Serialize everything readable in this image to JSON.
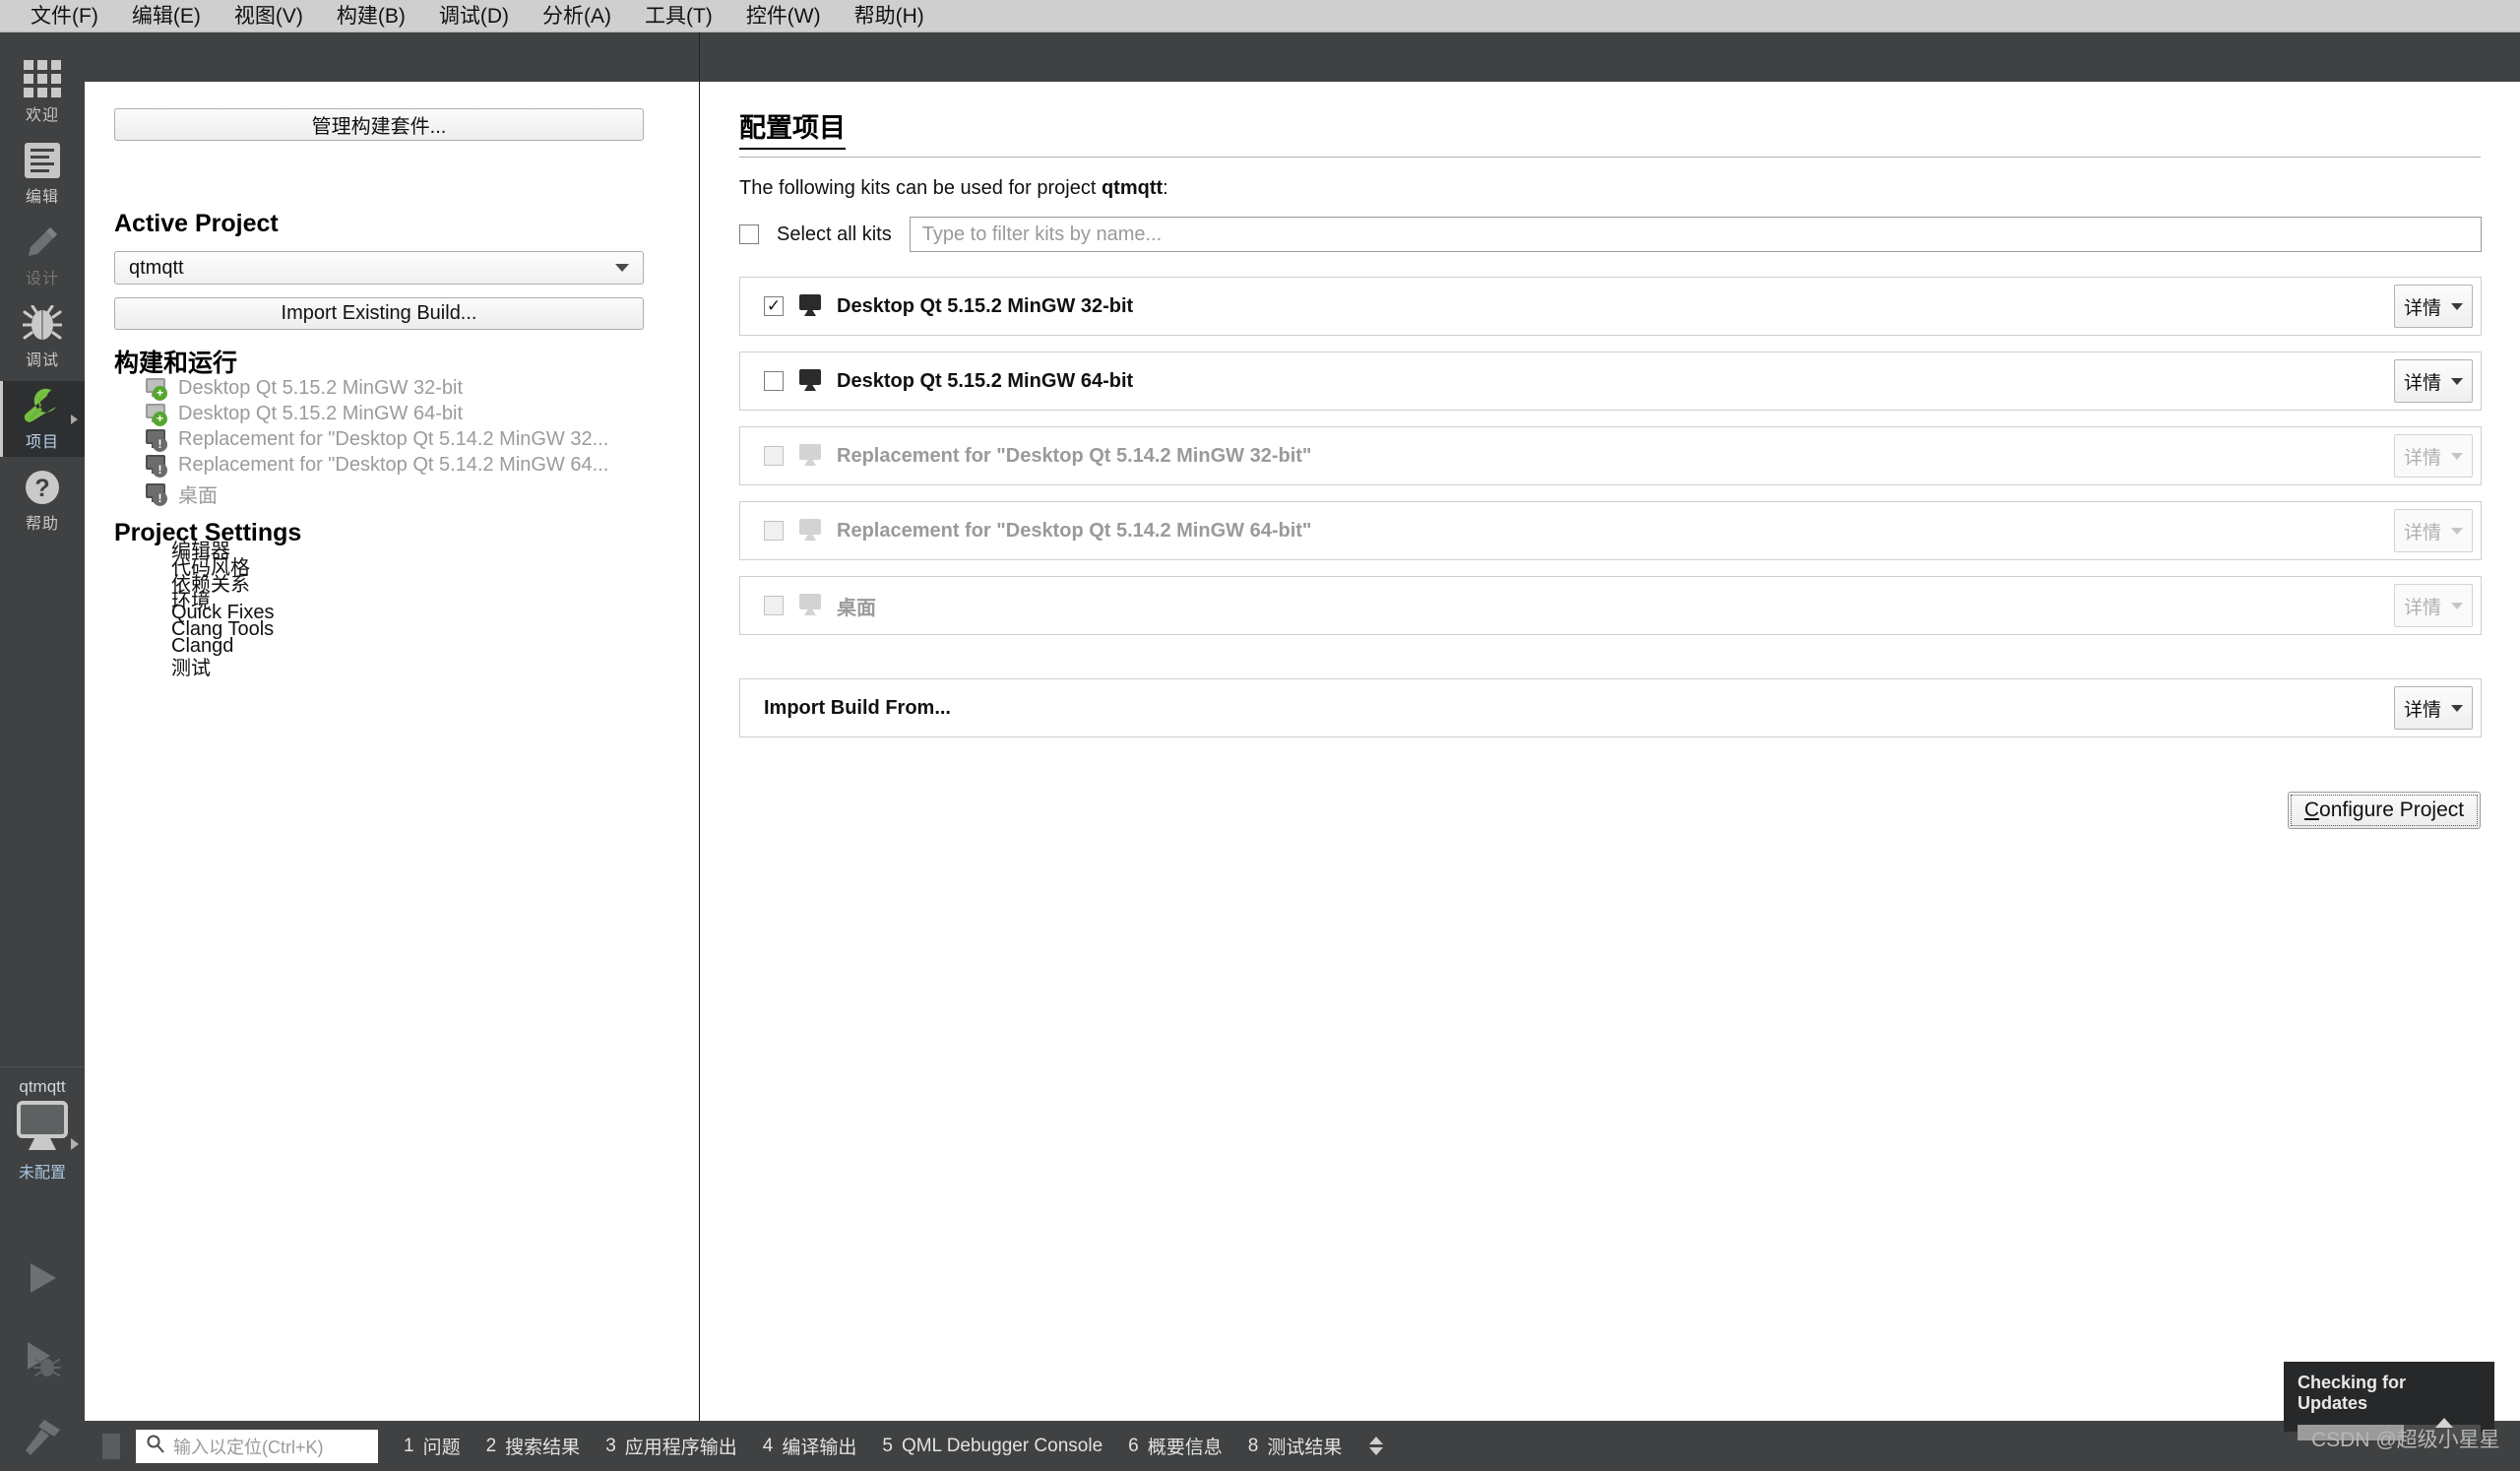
{
  "menubar": {
    "items": [
      {
        "label": "文件(F)"
      },
      {
        "label": "编辑(E)"
      },
      {
        "label": "视图(V)"
      },
      {
        "label": "构建(B)"
      },
      {
        "label": "调试(D)"
      },
      {
        "label": "分析(A)"
      },
      {
        "label": "工具(T)"
      },
      {
        "label": "控件(W)"
      },
      {
        "label": "帮助(H)"
      }
    ]
  },
  "modebar": {
    "items": [
      {
        "label": "欢迎",
        "icon": "grid-icon",
        "state": "normal"
      },
      {
        "label": "编辑",
        "icon": "document-lines-icon",
        "state": "normal"
      },
      {
        "label": "设计",
        "icon": "pencil-icon",
        "state": "disabled"
      },
      {
        "label": "调试",
        "icon": "bug-icon",
        "state": "normal"
      },
      {
        "label": "项目",
        "icon": "wrench-icon",
        "state": "active"
      },
      {
        "label": "帮助",
        "icon": "question-mark-icon",
        "state": "normal"
      }
    ],
    "kit_selector": {
      "project": "qtmqtt",
      "state": "未配置",
      "icon": "monitor-icon"
    },
    "actions": [
      {
        "name": "run",
        "icon": "play-icon"
      },
      {
        "name": "debug",
        "icon": "play-bug-icon"
      },
      {
        "name": "build",
        "icon": "hammer-icon"
      }
    ]
  },
  "left_panel": {
    "manage_kits_label": "管理构建套件...",
    "active_project_title": "Active Project",
    "active_project_value": "qtmqtt",
    "import_existing_label": "Import Existing Build...",
    "build_run_title": "构建和运行",
    "build_run_items": [
      {
        "label": "Desktop Qt 5.15.2 MinGW 32-bit",
        "icon": "monitor-plus-icon",
        "badge": "plus"
      },
      {
        "label": "Desktop Qt 5.15.2 MinGW 64-bit",
        "icon": "monitor-plus-icon",
        "badge": "plus"
      },
      {
        "label": "Replacement for \"Desktop Qt 5.14.2 MinGW 32...",
        "icon": "monitor-warning-icon",
        "badge": "warn"
      },
      {
        "label": "Replacement for \"Desktop Qt 5.14.2 MinGW 64...",
        "icon": "monitor-warning-icon",
        "badge": "warn"
      },
      {
        "label": "桌面",
        "icon": "monitor-warning-icon",
        "badge": "warn"
      }
    ],
    "project_settings_title": "Project Settings",
    "project_settings_items": [
      {
        "label": "编辑器"
      },
      {
        "label": "代码风格"
      },
      {
        "label": "依赖关系"
      },
      {
        "label": "环境"
      },
      {
        "label": "Quick Fixes"
      },
      {
        "label": "Clang Tools"
      },
      {
        "label": "Clangd"
      },
      {
        "label": "测试"
      }
    ]
  },
  "main": {
    "page_title": "配置项目",
    "intro_prefix": "The following kits can be used for project ",
    "intro_project": "qtmqtt",
    "intro_suffix": ":",
    "select_all_label": "Select all kits",
    "filter_placeholder": "Type to filter kits by name...",
    "details_label": "详情",
    "kits": [
      {
        "label": "Desktop Qt 5.15.2 MinGW 32-bit",
        "checked": true,
        "enabled": true,
        "icon": "monitor-icon"
      },
      {
        "label": "Desktop Qt 5.15.2 MinGW 64-bit",
        "checked": false,
        "enabled": true,
        "icon": "monitor-icon"
      },
      {
        "label": "Replacement for \"Desktop Qt 5.14.2 MinGW 32-bit\"",
        "checked": false,
        "enabled": false,
        "icon": "monitor-icon"
      },
      {
        "label": "Replacement for \"Desktop Qt 5.14.2 MinGW 64-bit\"",
        "checked": false,
        "enabled": false,
        "icon": "monitor-icon"
      },
      {
        "label": "桌面",
        "checked": false,
        "enabled": false,
        "icon": "monitor-icon"
      }
    ],
    "import_build_label": "Import Build From...",
    "configure_accel": "C",
    "configure_rest": "onfigure Project"
  },
  "updates_popup": {
    "title": "Checking for Updates",
    "progress_percent": 58
  },
  "watermark": "CSDN @超级小星星",
  "statusbar": {
    "locator_placeholder": "输入以定位(Ctrl+K)",
    "items": [
      {
        "num": "1",
        "label": "问题"
      },
      {
        "num": "2",
        "label": "搜索结果"
      },
      {
        "num": "3",
        "label": "应用程序输出"
      },
      {
        "num": "4",
        "label": "编译输出"
      },
      {
        "num": "5",
        "label": "QML Debugger Console"
      },
      {
        "num": "6",
        "label": "概要信息"
      },
      {
        "num": "8",
        "label": "测试结果"
      }
    ]
  },
  "colors": {
    "dark_chrome": "#3f4142",
    "menu_bg": "#cfcfcf",
    "active_mode_bg": "#2d2f30",
    "accent_green": "#55a630",
    "popup_bg": "#26282a"
  }
}
